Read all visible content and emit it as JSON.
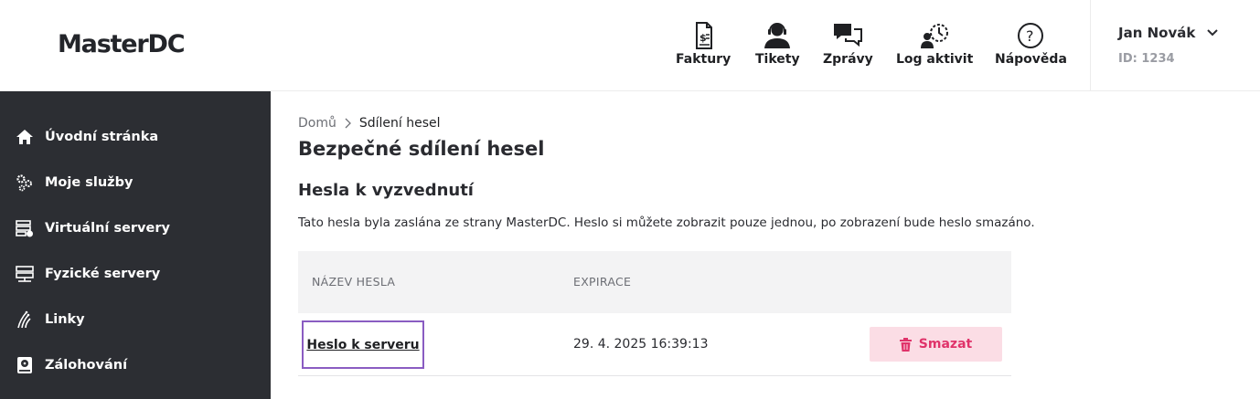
{
  "header": {
    "logo": "MasterDC",
    "nav": [
      {
        "label": "Faktury",
        "icon": "invoice-icon"
      },
      {
        "label": "Tikety",
        "icon": "support-agent-icon"
      },
      {
        "label": "Zprávy",
        "icon": "chat-bubbles-icon"
      },
      {
        "label": "Log aktivit",
        "icon": "activity-log-icon"
      },
      {
        "label": "Nápověda",
        "icon": "help-circle-icon"
      }
    ],
    "user": {
      "name": "Jan Novák",
      "id": "ID: 1234"
    }
  },
  "sidebar": {
    "items": [
      {
        "label": "Úvodní stránka",
        "icon": "home-icon"
      },
      {
        "label": "Moje služby",
        "icon": "gears-icon"
      },
      {
        "label": "Virtuální servery",
        "icon": "virtual-server-icon"
      },
      {
        "label": "Fyzické servery",
        "icon": "physical-server-icon"
      },
      {
        "label": "Linky",
        "icon": "fiber-lines-icon"
      },
      {
        "label": "Zálohování",
        "icon": "backup-drive-icon"
      }
    ]
  },
  "main": {
    "breadcrumb": {
      "home": "Domů",
      "current": "Sdílení hesel"
    },
    "title": "Bezpečné sdílení hesel",
    "section_title": "Hesla k vyzvednutí",
    "description": "Tato hesla byla zaslána ze strany MasterDC. Heslo si můžete zobrazit pouze jednou, po zobrazení bude heslo smazáno.",
    "table": {
      "columns": [
        "NÁZEV HESLA",
        "EXPIRACE"
      ],
      "rows": [
        {
          "name": "Heslo k serveru",
          "expiration": "29. 4. 2025 16:39:13",
          "delete_label": "Smazat"
        }
      ]
    }
  },
  "colors": {
    "sidebar_bg": "#2c2e33",
    "highlight_border": "#8a5cc2",
    "delete_bg": "#fbdde5",
    "delete_text": "#e0336a"
  }
}
